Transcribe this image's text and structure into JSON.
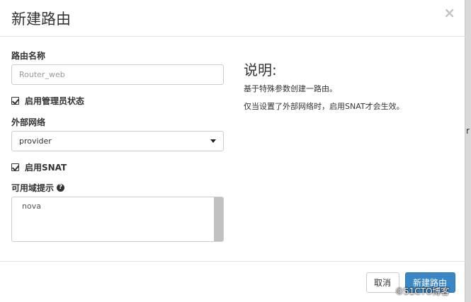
{
  "dialog": {
    "title": "新建路由",
    "close_label": "×"
  },
  "form": {
    "router_name": {
      "label": "路由名称",
      "placeholder": "Router_web"
    },
    "admin_state": {
      "label": "启用管理员状态",
      "checked": true
    },
    "external_network": {
      "label": "外部网络",
      "selected": "provider"
    },
    "enable_snat": {
      "label": "启用SNAT",
      "checked": true
    },
    "availability_zone": {
      "label": "可用域提示",
      "help_glyph": "?",
      "options": [
        "nova"
      ]
    }
  },
  "help": {
    "title": "说明:",
    "lines": [
      "基于特殊参数创建一路由。",
      "仅当设置了外部网络时，启用SNAT才会生效。"
    ]
  },
  "footer": {
    "cancel_label": "取消",
    "create_label": "新建路由"
  },
  "background": {
    "edge_glyph": "r"
  },
  "watermark": "©51CTO博客",
  "colors": {
    "primary": "#3a87c8",
    "backdrop": "#7d7d7d",
    "border": "#cccccc"
  }
}
